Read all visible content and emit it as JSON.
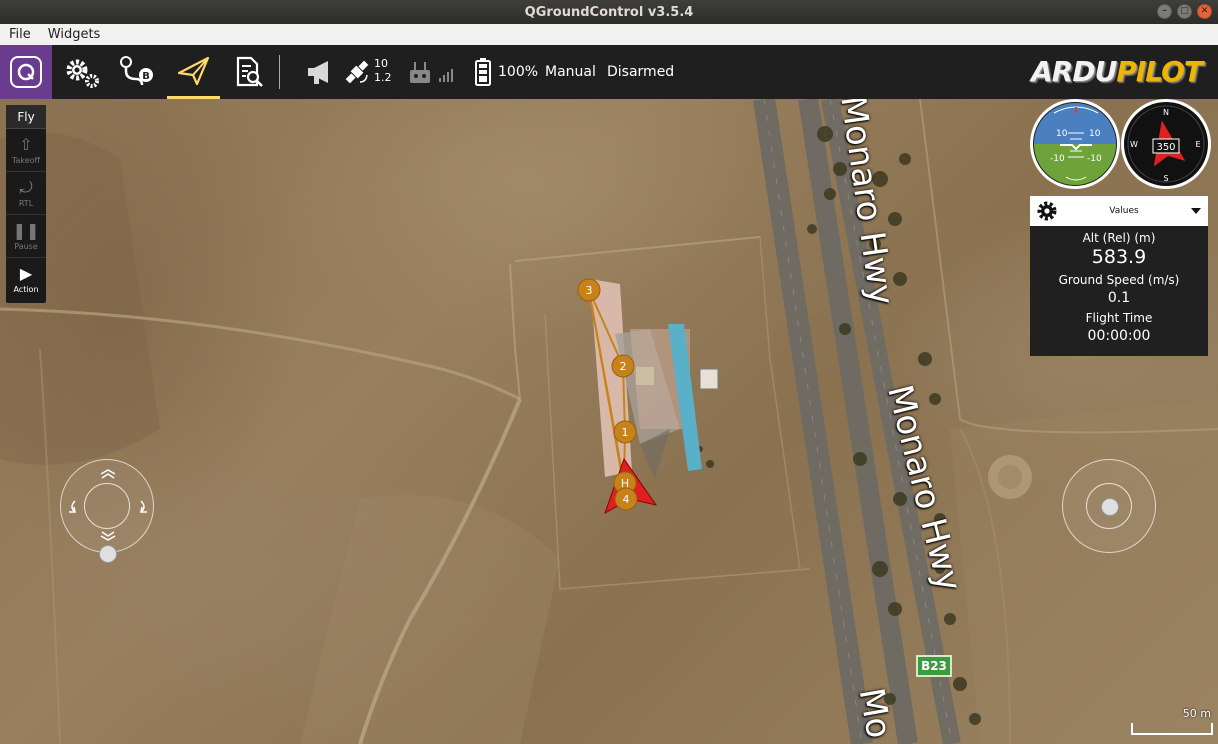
{
  "window": {
    "title": "QGroundControl v3.5.4",
    "buttons": [
      "–",
      "□",
      "✕"
    ]
  },
  "menu": {
    "items": [
      "File",
      "Widgets"
    ]
  },
  "toolbar": {
    "gps": {
      "satellites": "10",
      "hdop": "1.2"
    },
    "battery": "100%",
    "flight_mode": "Manual",
    "armed_status": "Disarmed",
    "brand": {
      "part1": "ARDU",
      "part2": "PILOT"
    }
  },
  "fly_panel": {
    "title": "Fly",
    "items": [
      {
        "label": "Takeoff",
        "icon": "takeoff-icon"
      },
      {
        "label": "RTL",
        "icon": "rtl-icon"
      },
      {
        "label": "Pause",
        "icon": "pause-icon"
      },
      {
        "label": "Action",
        "icon": "play-icon"
      }
    ]
  },
  "attitude": {
    "pitch_marks": [
      "10",
      "10",
      "-10",
      "-10"
    ]
  },
  "compass": {
    "heading": "350",
    "n": "N",
    "s": "S",
    "e": "E",
    "w": "W"
  },
  "values_panel": {
    "header": "Values",
    "alt_label": "Alt (Rel) (m)",
    "alt_value": "583.9",
    "speed_label": "Ground Speed (m/s)",
    "speed_value": "0.1",
    "time_label": "Flight Time",
    "time_value": "00:00:00"
  },
  "map": {
    "road_label": "Monaro Hwy",
    "road_label_partial": "Mo",
    "route_badge": "B23",
    "waypoints": [
      "3",
      "2",
      "1",
      "H",
      "4"
    ],
    "scale": "50 m"
  },
  "colors": {
    "accent": "#ffd96a",
    "logo_bg": "#6a3c8f",
    "waypoint": "#c8821a",
    "vehicle": "#e02020"
  }
}
